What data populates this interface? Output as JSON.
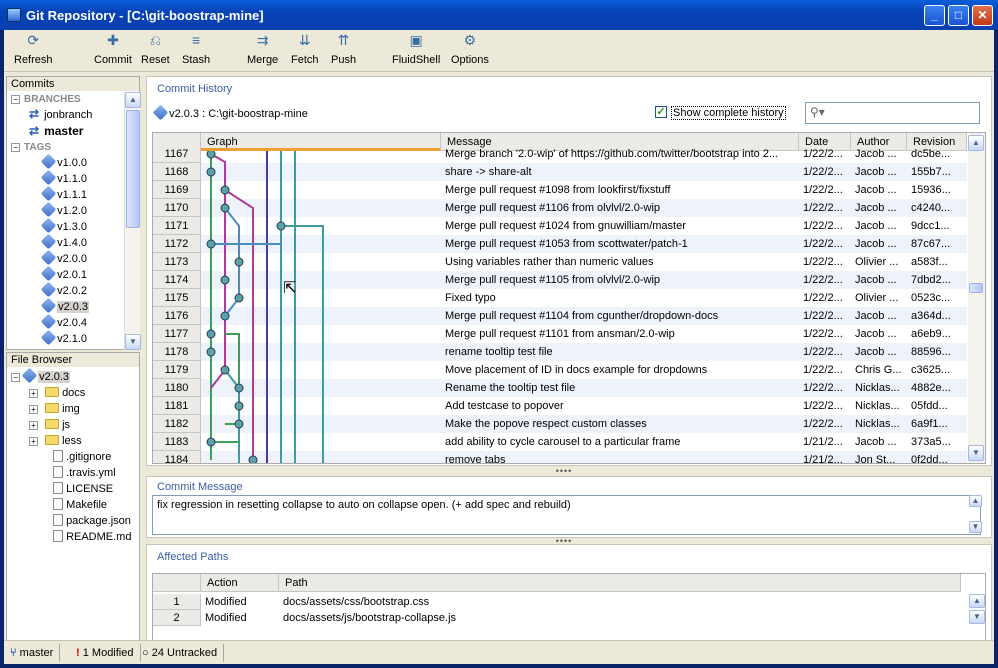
{
  "window": {
    "title": "Git Repository - [C:\\git-boostrap-mine]"
  },
  "toolbar": [
    {
      "label": "Refresh",
      "icon": "refresh-icon",
      "glyph": "⟳"
    },
    {
      "label": "Commit",
      "icon": "commit-icon",
      "glyph": "✚"
    },
    {
      "label": "Reset",
      "icon": "reset-icon",
      "glyph": "⎌"
    },
    {
      "label": "Stash",
      "icon": "stash-icon",
      "glyph": "≡"
    },
    {
      "label": "Merge",
      "icon": "merge-icon",
      "glyph": "⇉"
    },
    {
      "label": "Fetch",
      "icon": "fetch-icon",
      "glyph": "⇊"
    },
    {
      "label": "Push",
      "icon": "push-icon",
      "glyph": "⇈"
    },
    {
      "label": "FluidShell",
      "icon": "shell-icon",
      "glyph": "▣"
    },
    {
      "label": "Options",
      "icon": "options-icon",
      "glyph": "⚙"
    }
  ],
  "commits_panel": {
    "title": "Commits",
    "branches_label": "BRANCHES",
    "branches": [
      "jonbranch",
      "master"
    ],
    "tags_label": "TAGS",
    "tags": [
      "v1.0.0",
      "v1.1.0",
      "v1.1.1",
      "v1.2.0",
      "v1.3.0",
      "v1.4.0",
      "v2.0.0",
      "v2.0.1",
      "v2.0.2",
      "v2.0.3",
      "v2.0.4",
      "v2.1.0"
    ]
  },
  "file_browser": {
    "title": "File Browser",
    "root": "v2.0.3",
    "folders": [
      "docs",
      "img",
      "js",
      "less"
    ],
    "files": [
      ".gitignore",
      ".travis.yml",
      "LICENSE",
      "Makefile",
      "package.json",
      "README.md"
    ]
  },
  "history": {
    "title": "Commit History",
    "repo": "v2.0.3 : C:\\git-boostrap-mine",
    "show_complete": "Show complete history",
    "columns": [
      "Graph",
      "Message",
      "Date",
      "Author",
      "Revision"
    ],
    "rows": [
      {
        "n": "1167",
        "msg": "Merge branch '2.0-wip' of https://github.com/twitter/bootstrap into 2...",
        "date": "1/22/2...",
        "author": "Jacob ...",
        "rev": "dc5be..."
      },
      {
        "n": "1168",
        "msg": "share -> share-alt",
        "date": "1/22/2...",
        "author": "Jacob ...",
        "rev": "155b7..."
      },
      {
        "n": "1169",
        "msg": "Merge pull request #1098 from lookfirst/fixstuff",
        "date": "1/22/2...",
        "author": "Jacob ...",
        "rev": "15936..."
      },
      {
        "n": "1170",
        "msg": "Merge pull request #1106 from olvlvl/2.0-wip",
        "date": "1/22/2...",
        "author": "Jacob ...",
        "rev": "c4240..."
      },
      {
        "n": "1171",
        "msg": "Merge pull request #1024 from gnuwilliam/master",
        "date": "1/22/2...",
        "author": "Jacob ...",
        "rev": "9dcc1..."
      },
      {
        "n": "1172",
        "msg": "Merge pull request #1053 from scottwater/patch-1",
        "date": "1/22/2...",
        "author": "Jacob ...",
        "rev": "87c67..."
      },
      {
        "n": "1173",
        "msg": "Using variables rather than numeric values",
        "date": "1/22/2...",
        "author": "Olivier ...",
        "rev": "a583f..."
      },
      {
        "n": "1174",
        "msg": "Merge pull request #1105 from olvlvl/2.0-wip",
        "date": "1/22/2...",
        "author": "Jacob ...",
        "rev": "7dbd2..."
      },
      {
        "n": "1175",
        "msg": "Fixed typo",
        "date": "1/22/2...",
        "author": "Olivier ...",
        "rev": "0523c..."
      },
      {
        "n": "1176",
        "msg": "Merge pull request #1104 from cgunther/dropdown-docs",
        "date": "1/22/2...",
        "author": "Jacob ...",
        "rev": "a364d..."
      },
      {
        "n": "1177",
        "msg": "Merge pull request #1101 from ansman/2.0-wip",
        "date": "1/22/2...",
        "author": "Jacob ...",
        "rev": "a6eb9..."
      },
      {
        "n": "1178",
        "msg": "rename tooltip test file",
        "date": "1/22/2...",
        "author": "Jacob ...",
        "rev": "88596..."
      },
      {
        "n": "1179",
        "msg": "Move placement of ID in docs example for dropdowns",
        "date": "1/22/2...",
        "author": "Chris G...",
        "rev": "c3625..."
      },
      {
        "n": "1180",
        "msg": "Rename the tooltip test file",
        "date": "1/22/2...",
        "author": "Nicklas...",
        "rev": "4882e..."
      },
      {
        "n": "1181",
        "msg": "Add testcase to popover",
        "date": "1/22/2...",
        "author": "Nicklas...",
        "rev": "05fdd..."
      },
      {
        "n": "1182",
        "msg": "Make the popove respect custom classes",
        "date": "1/22/2...",
        "author": "Nicklas...",
        "rev": "6a9f1..."
      },
      {
        "n": "1183",
        "msg": "add ability to cycle carousel to a particular frame",
        "date": "1/21/2...",
        "author": "Jacob ...",
        "rev": "373a5..."
      },
      {
        "n": "1184",
        "msg": "remove tabs",
        "date": "1/21/2...",
        "author": "Jon St...",
        "rev": "0f2dd..."
      }
    ]
  },
  "commit_message": {
    "title": "Commit Message",
    "text": "fix regression in resetting collapse to auto on collapse open. (+ add spec and rebuild)"
  },
  "affected_paths": {
    "title": "Affected Paths",
    "columns": [
      "Action",
      "Path"
    ],
    "rows": [
      {
        "n": "1",
        "action": "Modified",
        "path": "docs/assets/css/bootstrap.css"
      },
      {
        "n": "2",
        "action": "Modified",
        "path": "docs/assets/js/bootstrap-collapse.js"
      }
    ]
  },
  "status": {
    "branch": "master",
    "modified": "1 Modified",
    "untracked": "24 Untracked"
  },
  "colors": {
    "accent": "#3a5ea5",
    "graph_teal": "#3a9c9c",
    "graph_magenta": "#b0399c",
    "graph_purple": "#4a3a9c",
    "graph_green": "#3aa05a",
    "graph_blue": "#4a8cc0"
  }
}
